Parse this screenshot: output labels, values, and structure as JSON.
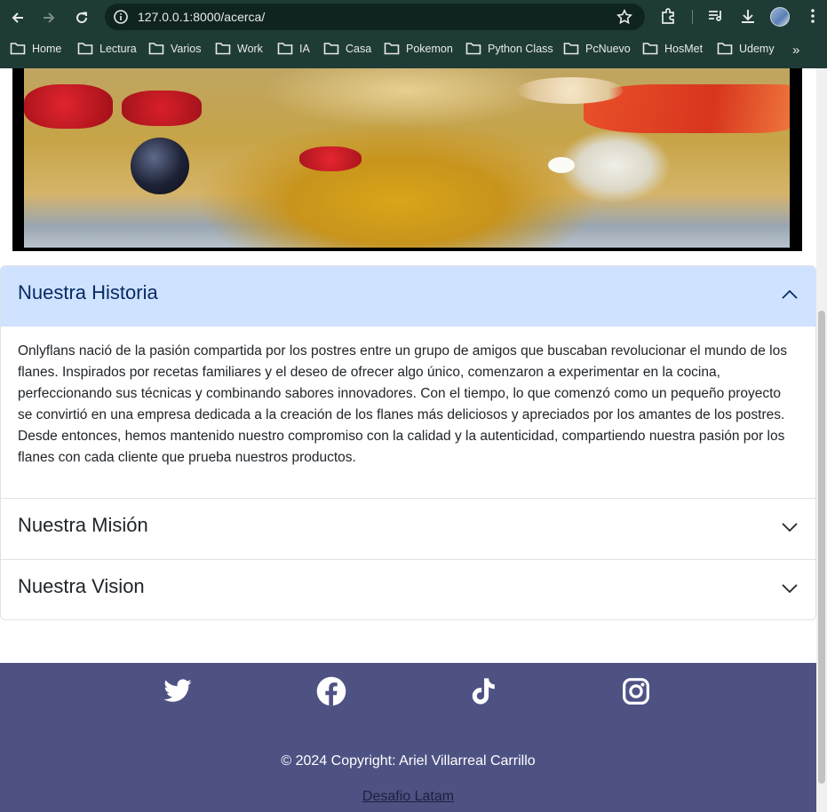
{
  "browser": {
    "url": "127.0.0.1:8000/acerca/",
    "bookmarks": [
      "Home",
      "Lectura",
      "Varios",
      "Work",
      "IA",
      "Casa",
      "Pokemon",
      "Python Class",
      "PcNuevo",
      "HosMet",
      "Udemy"
    ],
    "more": "»"
  },
  "accordion": {
    "items": [
      {
        "title": "Nuestra Historia",
        "expanded": true,
        "body": "Onlyflans nació de la pasión compartida por los postres entre un grupo de amigos que buscaban revolucionar el mundo de los flanes. Inspirados por recetas familiares y el deseo de ofrecer algo único, comenzaron a experimentar en la cocina, perfeccionando sus técnicas y combinando sabores innovadores. Con el tiempo, lo que comenzó como un pequeño proyecto se convirtió en una empresa dedicada a la creación de los flanes más deliciosos y apreciados por los amantes de los postres. Desde entonces, hemos mantenido nuestro compromiso con la calidad y la autenticidad, compartiendo nuestra pasión por los flanes con cada cliente que prueba nuestros productos."
      },
      {
        "title": "Nuestra Misión",
        "expanded": false
      },
      {
        "title": "Nuestra Vision",
        "expanded": false
      }
    ]
  },
  "footer": {
    "social": [
      "twitter-icon",
      "facebook-icon",
      "tiktok-icon",
      "instagram-icon"
    ],
    "copyright": "© 2024 Copyright: Ariel Villarreal Carrillo",
    "link": "Desafio Latam"
  },
  "colors": {
    "accordion_active_bg": "#cfe2ff",
    "footer_bg": "#4e5283",
    "chrome_bg": "#1f3b35"
  }
}
